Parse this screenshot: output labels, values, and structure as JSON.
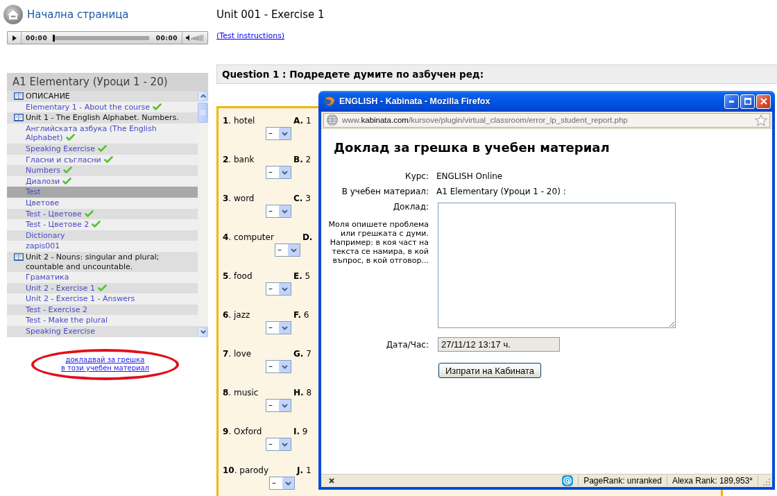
{
  "home_link": {
    "label": "Начална страница"
  },
  "audio_player": {
    "elapsed": "00:00",
    "duration": "00:00",
    "level": 0
  },
  "course_panel": {
    "title": "A1 Elementary (Уроци 1 - 20)",
    "sections": [
      {
        "title": "ОПИСАНИЕ",
        "children": [
          {
            "label": "Elementary 1 - About the course",
            "completed": true,
            "selected": false
          }
        ]
      },
      {
        "title": "Unit 1 - The English Alphabet. Numbers.",
        "children": [
          {
            "label": "Английската азбука (The English Alphabet)",
            "completed": true,
            "selected": false
          },
          {
            "label": "Speaking Exercise",
            "completed": true,
            "selected": false
          },
          {
            "label": "Гласни и съгласни",
            "completed": true,
            "selected": false
          },
          {
            "label": "Numbers",
            "completed": true,
            "selected": false
          },
          {
            "label": "Диалози",
            "completed": true,
            "selected": false
          },
          {
            "label": "Test",
            "completed": false,
            "selected": true
          },
          {
            "label": "Цветове",
            "completed": false,
            "selected": false
          },
          {
            "label": "Test - Цветове",
            "completed": true,
            "selected": false
          },
          {
            "label": "Test - Цветове 2",
            "completed": true,
            "selected": false
          },
          {
            "label": "Dictionary",
            "completed": false,
            "selected": false
          },
          {
            "label": "zapis001",
            "completed": false,
            "selected": false
          }
        ]
      },
      {
        "title": "Unit 2 - Nouns: singular and plural; countable and uncountable.",
        "children": [
          {
            "label": "Граматика",
            "completed": false,
            "selected": false
          },
          {
            "label": "Unit 2 - Exercise 1",
            "completed": true,
            "selected": false
          },
          {
            "label": "Unit 2 - Exercise 1 - Answers",
            "completed": false,
            "selected": false
          },
          {
            "label": "Test - Exercise 2",
            "completed": false,
            "selected": false
          },
          {
            "label": "Test - Make the plural",
            "completed": false,
            "selected": false
          },
          {
            "label": "Speaking Exercise",
            "completed": false,
            "selected": false
          }
        ]
      }
    ]
  },
  "report_link": {
    "lines": [
      "докладвай за грешка",
      "в този учебен материал"
    ]
  },
  "exercise": {
    "title": "Unit 001 - Exercise 1",
    "instructions_link": "(Test instructions)",
    "question": "Question 1 : Подредете думите по азбучен ред:",
    "rows": [
      {
        "word": "**1**. hotel",
        "option": "**A.** 1",
        "answer": "–"
      },
      {
        "word": "**2**. bank",
        "option": "**B.** 2",
        "answer": "–"
      },
      {
        "word": "**3**. word",
        "option": "**C.** 3",
        "answer": "–"
      },
      {
        "word": "**4**. computer",
        "option": "**D.**",
        "answer": "–"
      },
      {
        "word": "**5**. food",
        "option": "**E.** 5",
        "answer": "–"
      },
      {
        "word": "**6**. jazz",
        "option": "**F.** 6",
        "answer": "–"
      },
      {
        "word": "**7**. love",
        "option": "**G.** 7",
        "answer": "–"
      },
      {
        "word": "**8**. music",
        "option": "**H.** 8",
        "answer": "–"
      },
      {
        "word": "**9**. Oxford",
        "option": "**I.** 9",
        "answer": "–"
      },
      {
        "word": "**10**. parody",
        "option": "**J.** 1",
        "answer": "–"
      }
    ]
  },
  "popup": {
    "title": "ENGLISH - Kabinata - Mozilla Firefox",
    "url": {
      "prefix": "www.",
      "domain": "kabinata.com",
      "path": "/kursove/plugin/virtual_classroom/error_lp_student_report.php"
    },
    "heading": "Доклад за грешка в учебен материал",
    "fields": [
      {
        "kind": "text",
        "label": "Курс:",
        "value": "ENGLISH Online"
      },
      {
        "kind": "text",
        "label": "В учебен материал:",
        "value": "A1 Elementary (Уроци 1 - 20) :"
      },
      {
        "kind": "textarea",
        "label": "Доклад:",
        "hint": "Моля опишете проблема или грешката с думи. Например: в коя част на текста се намира, в кой въпрос, в кой отговор..."
      },
      {
        "kind": "input",
        "label": "Дата/Час:",
        "value": "27/11/12 13:17 ч.",
        "disabled": true
      }
    ],
    "submit": "Изпрати на Кабината",
    "status_bar": {
      "pagerank": "PageRank: unranked",
      "alexa": "Alexa Rank: 189,953*"
    }
  }
}
